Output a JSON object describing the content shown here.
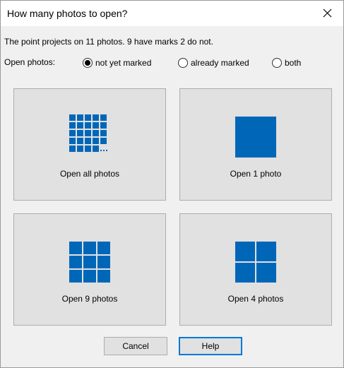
{
  "window": {
    "title": "How many photos to open?"
  },
  "info_text": "The point projects on 11 photos. 9 have marks 2 do not.",
  "open_photos": {
    "label": "Open photos:",
    "options": [
      {
        "label": "not yet marked",
        "selected": true
      },
      {
        "label": "already marked",
        "selected": false
      },
      {
        "label": "both",
        "selected": false
      }
    ]
  },
  "choices": {
    "all": {
      "label": "Open all photos",
      "icon": "grid-many-icon"
    },
    "one": {
      "label": "Open 1 photo",
      "icon": "single-square-icon"
    },
    "nine": {
      "label": "Open 9 photos",
      "icon": "grid-3x3-icon"
    },
    "four": {
      "label": "Open 4 photos",
      "icon": "grid-2x2-icon"
    }
  },
  "buttons": {
    "cancel": "Cancel",
    "help": "Help"
  },
  "colors": {
    "accent": "#0067b8",
    "focus_border": "#0078d7",
    "button_face": "#e1e1e1",
    "dialog_bg": "#f0f0f0"
  }
}
